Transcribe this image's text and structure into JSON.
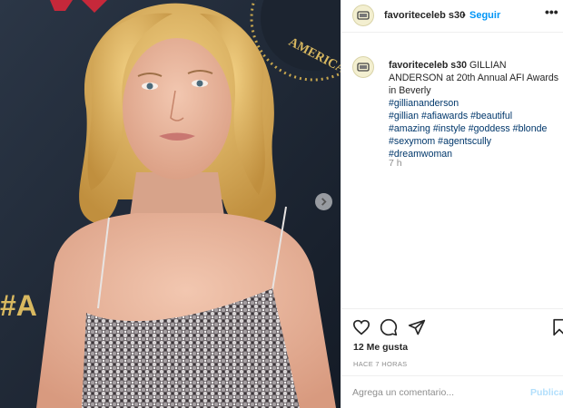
{
  "post": {
    "username": "favoriteceleb s30",
    "dot": "•",
    "follow_label": "Seguir",
    "more_label": "•••"
  },
  "caption": {
    "username": "favoriteceleb s30",
    "text": "GILLIAN ANDERSON at 20th Annual AFI Awards in Beverly",
    "hashtags": [
      "#gilliananderson",
      "#gillian",
      "#afiawards",
      "#beautiful",
      "#amazing",
      "#instyle",
      "#goddess",
      "#blonde",
      "#sexymom",
      "#agentscully",
      "#dreamwoman"
    ],
    "time": "7 h"
  },
  "photo": {
    "backdrop_text": "AMERICA",
    "backdrop_text_2": "#A",
    "alt": "Photo"
  },
  "actions": {
    "likes": "12 Me gusta",
    "time_ago": "HACE 7 HORAS"
  },
  "comment": {
    "placeholder": "Agrega un comentario...",
    "publish_label": "Publicar"
  },
  "colors": {
    "link": "#00376b",
    "follow": "#0095f6",
    "publish_disabled": "#b2dffc",
    "muted": "#8e8e8e"
  }
}
